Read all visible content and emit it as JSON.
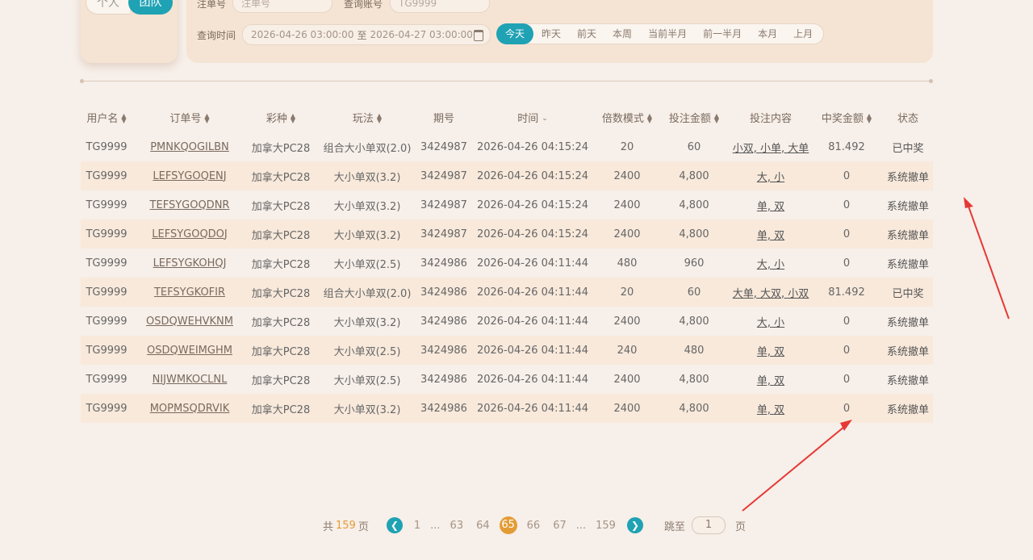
{
  "filters": {
    "scope_tabs": [
      "个人",
      "团队"
    ],
    "order_label": "注单号",
    "order_placeholder": "注单号",
    "account_label": "查询账号",
    "account_value": "TG9999",
    "time_label": "查询时间",
    "time_start": "2026-04-26 03:00:00",
    "time_sep": "至",
    "time_end": "2026-04-27 03:00:00",
    "quick": [
      "今天",
      "昨天",
      "前天",
      "本周",
      "当前半月",
      "前一半月",
      "本月",
      "上月"
    ]
  },
  "table": {
    "columns": [
      "用户名",
      "订单号",
      "彩种",
      "玩法",
      "期号",
      "时间",
      "倍数模式",
      "投注金额",
      "投注内容",
      "中奖金额",
      "状态"
    ],
    "rows": [
      [
        "TG9999",
        "PMNKQOGILBN",
        "加拿大PC28",
        "组合大小单双(2.0)",
        "3424987",
        "2026-04-26 04:15:24",
        "20",
        "60",
        "小双, 小单, 大单",
        "81.492",
        "已中奖"
      ],
      [
        "TG9999",
        "LEFSYGOQENJ",
        "加拿大PC28",
        "大小单双(3.2)",
        "3424987",
        "2026-04-26 04:15:24",
        "2400",
        "4,800",
        "大, 小",
        "0",
        "系统撤单"
      ],
      [
        "TG9999",
        "TEFSYGOQDNR",
        "加拿大PC28",
        "大小单双(3.2)",
        "3424987",
        "2026-04-26 04:15:24",
        "2400",
        "4,800",
        "单, 双",
        "0",
        "系统撤单"
      ],
      [
        "TG9999",
        "LEFSYGOQDOJ",
        "加拿大PC28",
        "大小单双(3.2)",
        "3424987",
        "2026-04-26 04:15:24",
        "2400",
        "4,800",
        "单, 双",
        "0",
        "系统撤单"
      ],
      [
        "TG9999",
        "LEFSYGKOHQJ",
        "加拿大PC28",
        "大小单双(2.5)",
        "3424986",
        "2026-04-26 04:11:44",
        "480",
        "960",
        "大, 小",
        "0",
        "系统撤单"
      ],
      [
        "TG9999",
        "TEFSYGKOFIR",
        "加拿大PC28",
        "组合大小单双(2.0)",
        "3424986",
        "2026-04-26 04:11:44",
        "20",
        "60",
        "大单, 大双, 小双",
        "81.492",
        "已中奖"
      ],
      [
        "TG9999",
        "OSDQWEHVKNM",
        "加拿大PC28",
        "大小单双(3.2)",
        "3424986",
        "2026-04-26 04:11:44",
        "2400",
        "4,800",
        "大, 小",
        "0",
        "系统撤单"
      ],
      [
        "TG9999",
        "OSDQWEIMGHM",
        "加拿大PC28",
        "大小单双(2.5)",
        "3424986",
        "2026-04-26 04:11:44",
        "240",
        "480",
        "单, 双",
        "0",
        "系统撤单"
      ],
      [
        "TG9999",
        "NIJWMKOCLNL",
        "加拿大PC28",
        "大小单双(2.5)",
        "3424986",
        "2026-04-26 04:11:44",
        "2400",
        "4,800",
        "单, 双",
        "0",
        "系统撤单"
      ],
      [
        "TG9999",
        "MOPMSQDRVIK",
        "加拿大PC28",
        "大小单双(3.2)",
        "3424986",
        "2026-04-26 04:11:44",
        "2400",
        "4,800",
        "单, 双",
        "0",
        "系统撤单"
      ]
    ]
  },
  "pager": {
    "total_prefix": "共",
    "total_pages": "159",
    "total_suffix": "页",
    "pages": [
      "1",
      "...",
      "63",
      "64",
      "65",
      "66",
      "67",
      "...",
      "159"
    ],
    "current": "65",
    "jump_label": "跳至",
    "jump_value": "1",
    "jump_suffix": "页"
  },
  "icons": {
    "prev": "chevron-left-icon",
    "next": "chevron-right-icon",
    "calendar": "calendar-icon",
    "sort": "sort-icon"
  },
  "colors": {
    "accent": "#1fa2b4",
    "current_page": "#e39c35",
    "panel": "#f5e4d3",
    "arrow": "#e53935"
  }
}
